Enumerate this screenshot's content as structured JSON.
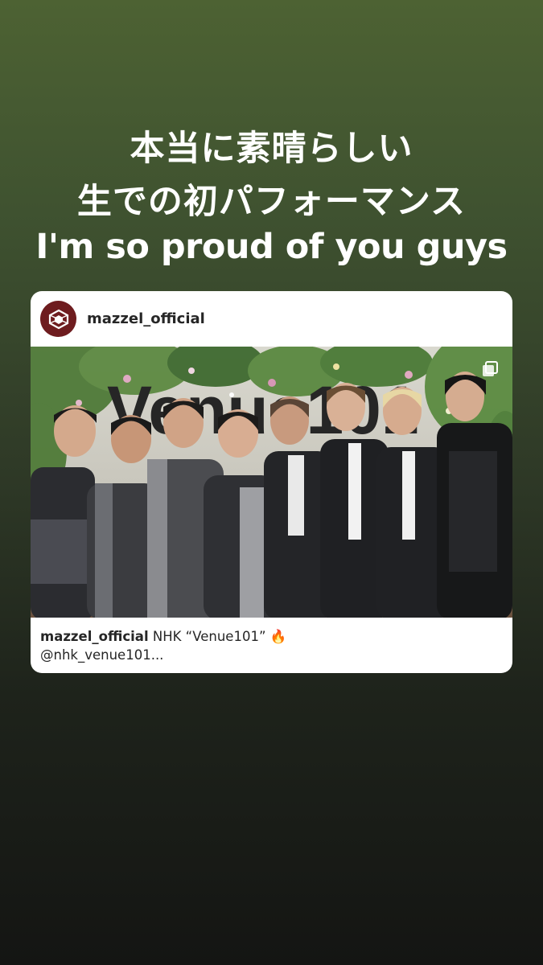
{
  "story": {
    "line1": "本当に素晴らしい",
    "line2": "生での初パフォーマンス",
    "line3": "I'm so proud of you guys"
  },
  "post": {
    "username": "mazzel_official",
    "image_sign_text": "Venue101",
    "caption_user": "mazzel_official",
    "caption_text": "NHK “Venue101” 🔥",
    "caption_line2": "@nhk_venue101..."
  },
  "colors": {
    "bg_top": "#4d6233",
    "bg_bottom": "#141513",
    "avatar_bg": "#6e1c1f",
    "card_bg": "#ffffff"
  },
  "icons": {
    "avatar": "brand-logo-icon",
    "multi": "multiple-images-icon"
  }
}
